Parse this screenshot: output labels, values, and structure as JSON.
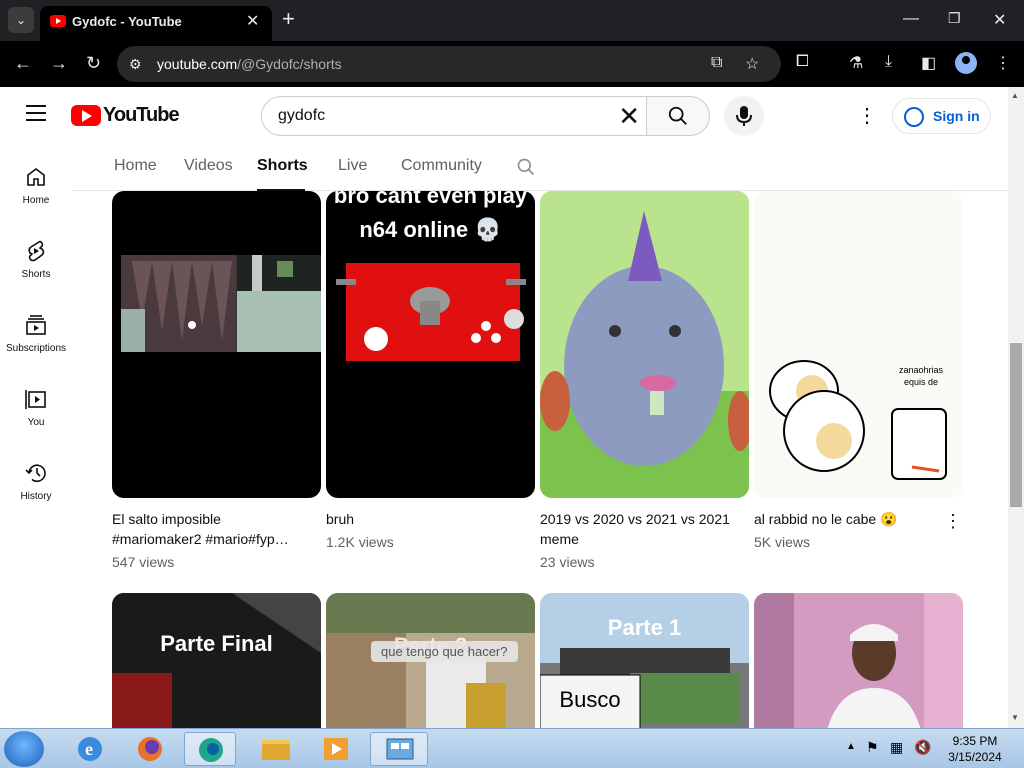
{
  "browser": {
    "tab_title": "Gydofc - YouTube",
    "url_host": "youtube.com",
    "url_path": "/@Gydofc/shorts"
  },
  "youtube": {
    "search_value": "gydofc",
    "logo_text": "YouTube",
    "signin_label": "Sign in"
  },
  "guide": [
    {
      "label": "Home",
      "icon": "home-icon"
    },
    {
      "label": "Shorts",
      "icon": "shorts-icon"
    },
    {
      "label": "Subscriptions",
      "icon": "subscriptions-icon"
    },
    {
      "label": "You",
      "icon": "you-icon"
    },
    {
      "label": "History",
      "icon": "history-icon"
    }
  ],
  "channel_tabs": [
    "Home",
    "Videos",
    "Shorts",
    "Live",
    "Community"
  ],
  "active_tab": "Shorts",
  "shorts": [
    {
      "title": "El salto imposible #mariomaker2 #mario#fyp…",
      "views": "547 views"
    },
    {
      "title": "bruh",
      "views": "1.2K views",
      "overlay": "bro cant even play n64 online 💀"
    },
    {
      "title": "2019 vs 2020 vs 2021 vs 2021 meme",
      "views": "23 views"
    },
    {
      "title": "al rabbid no le cabe 😮",
      "views": "5K views",
      "drawing_text": "zanaohrias equis de"
    }
  ],
  "shorts_row2": [
    {
      "overlay": "Parte Final"
    },
    {
      "overlay": "Parte 2",
      "subtitle": "que tengo que hacer?"
    },
    {
      "overlay": "Parte 1",
      "sign": "Busco"
    },
    {
      "overlay": ""
    }
  ],
  "taskbar": {
    "time": "9:35 PM",
    "date": "3/15/2024"
  }
}
